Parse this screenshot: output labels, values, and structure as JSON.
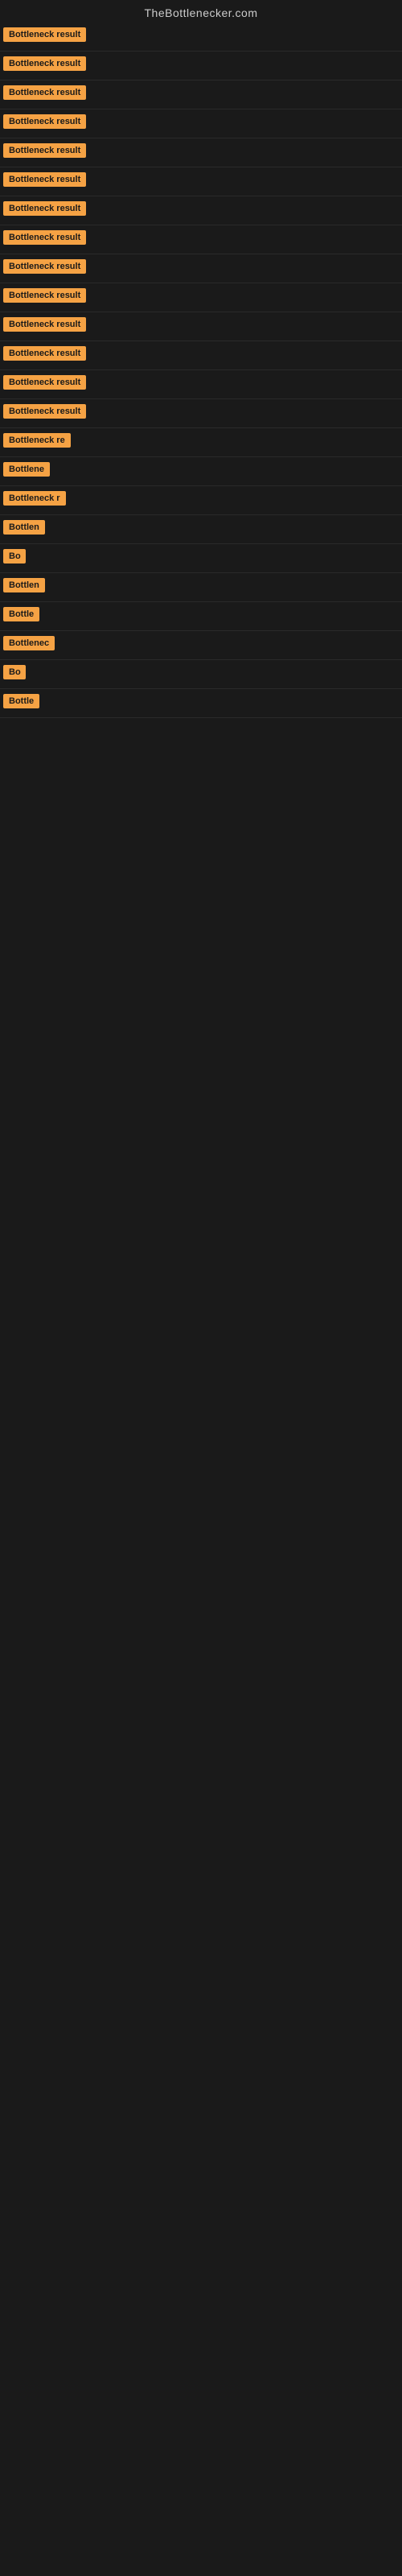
{
  "site": {
    "title": "TheBottlenecker.com"
  },
  "results": [
    {
      "label": "Bottleneck result",
      "visible_width": "full"
    },
    {
      "label": "Bottleneck result",
      "visible_width": "full"
    },
    {
      "label": "Bottleneck result",
      "visible_width": "full"
    },
    {
      "label": "Bottleneck result",
      "visible_width": "full"
    },
    {
      "label": "Bottleneck result",
      "visible_width": "full"
    },
    {
      "label": "Bottleneck result",
      "visible_width": "full"
    },
    {
      "label": "Bottleneck result",
      "visible_width": "full"
    },
    {
      "label": "Bottleneck result",
      "visible_width": "full"
    },
    {
      "label": "Bottleneck result",
      "visible_width": "full"
    },
    {
      "label": "Bottleneck result",
      "visible_width": "full"
    },
    {
      "label": "Bottleneck result",
      "visible_width": "full"
    },
    {
      "label": "Bottleneck result",
      "visible_width": "full"
    },
    {
      "label": "Bottleneck result",
      "visible_width": "full"
    },
    {
      "label": "Bottleneck result",
      "visible_width": "full"
    },
    {
      "label": "Bottleneck re",
      "visible_width": "partial-large"
    },
    {
      "label": "Bottlene",
      "visible_width": "partial-medium"
    },
    {
      "label": "Bottleneck r",
      "visible_width": "partial-large2"
    },
    {
      "label": "Bottlen",
      "visible_width": "partial-medium2"
    },
    {
      "label": "Bo",
      "visible_width": "tiny"
    },
    {
      "label": "Bottlen",
      "visible_width": "partial-medium2"
    },
    {
      "label": "Bottle",
      "visible_width": "partial-small"
    },
    {
      "label": "Bottlenec",
      "visible_width": "partial-medium3"
    },
    {
      "label": "Bo",
      "visible_width": "tiny"
    },
    {
      "label": "Bottle",
      "visible_width": "partial-small"
    }
  ],
  "badge_colors": {
    "background": "#f5a244",
    "text": "#1a1a1a"
  }
}
